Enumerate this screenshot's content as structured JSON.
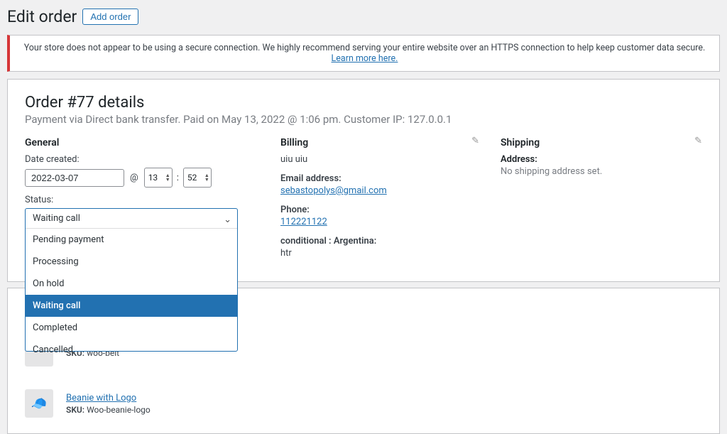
{
  "header": {
    "title": "Edit order",
    "add_label": "Add order"
  },
  "notice": {
    "text": "Your store does not appear to be using a secure connection. We highly recommend serving your entire website over an HTTPS connection to help keep customer data secure.",
    "link": "Learn more here."
  },
  "order": {
    "title": "Order #77 details",
    "subhead": "Payment via Direct bank transfer. Paid on May 13, 2022 @ 1:06 pm. Customer IP: 127.0.0.1"
  },
  "general": {
    "section": "General",
    "date_label": "Date created:",
    "date": "2022-03-07",
    "at": "@",
    "hour": "13",
    "min": "52",
    "colon": ":",
    "status_label": "Status:",
    "status_selected": "Waiting call",
    "status_options": [
      "Pending payment",
      "Processing",
      "On hold",
      "Waiting call",
      "Completed",
      "Cancelled"
    ]
  },
  "billing": {
    "section": "Billing",
    "name": "uiu uiu",
    "email_label": "Email address:",
    "email": "sebastopolys@gmail.com",
    "phone_label": "Phone:",
    "phone": "112221122",
    "cond_label": "conditional : Argentina:",
    "cond_value": "htr"
  },
  "shipping": {
    "section": "Shipping",
    "addr_label": "Address:",
    "addr_value": "No shipping address set."
  },
  "items": [
    {
      "name": "",
      "sku_label": "SKU:",
      "sku": "woo-belt",
      "glyph": ""
    },
    {
      "name": "Beanie with Logo",
      "sku_label": "SKU:",
      "sku": "Woo-beanie-logo",
      "glyph": "🧢"
    }
  ]
}
